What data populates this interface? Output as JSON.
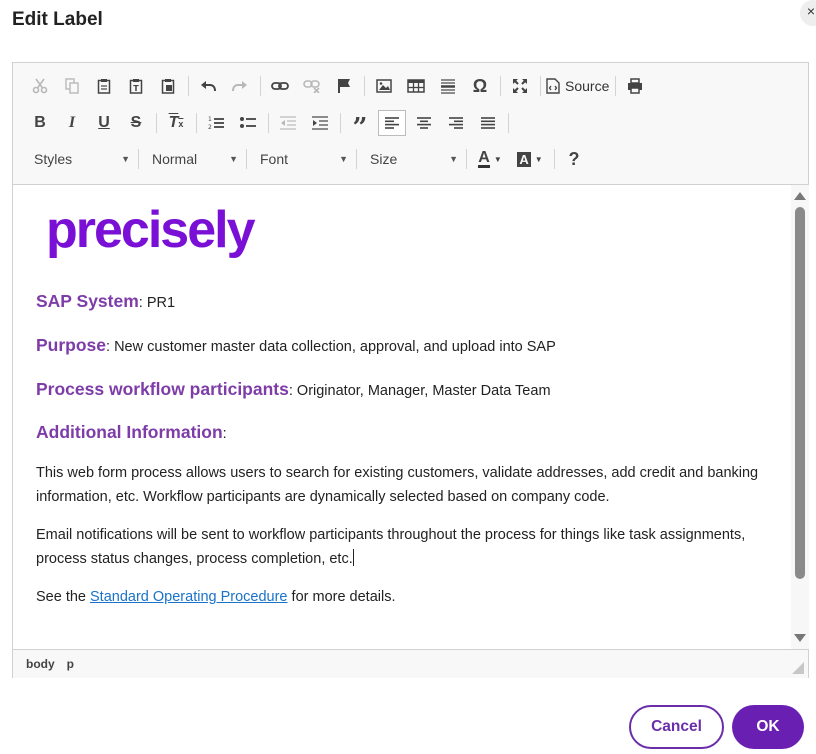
{
  "dialog": {
    "title": "Edit Label",
    "close_label": "×"
  },
  "toolbar": {
    "source_label": "Source",
    "styles_label": "Styles",
    "format_label": "Normal",
    "font_label": "Font",
    "size_label": "Size",
    "help_label": "?"
  },
  "content": {
    "logo_text": "precisely",
    "sap_system_label": "SAP System",
    "sap_system_value": ": PR1",
    "purpose_label": "Purpose",
    "purpose_value": ":  New customer master data collection, approval, and upload into SAP",
    "participants_label": "Process workflow participants",
    "participants_value": ": Originator, Manager, Master Data Team",
    "additional_label": "Additional Information",
    "additional_value": ":",
    "para1": "This web form process allows users to search for existing customers, validate addresses, add credit and banking information, etc.  Workflow participants are dynamically selected based on company code.",
    "para2": "Email notifications will be sent to workflow participants throughout the process for things like task assignments, process status changes, process completion, etc.",
    "para3_prefix": "See the ",
    "para3_link": "Standard Operating Procedure",
    "para3_suffix": " for more details."
  },
  "statusbar": {
    "path_body": "body",
    "path_p": "p"
  },
  "footer": {
    "cancel_label": "Cancel",
    "ok_label": "OK"
  },
  "colors": {
    "accent": "#6a1fb3",
    "heading": "#7e3ca8",
    "logo": "#7a10d6",
    "link": "#1a73c8"
  }
}
